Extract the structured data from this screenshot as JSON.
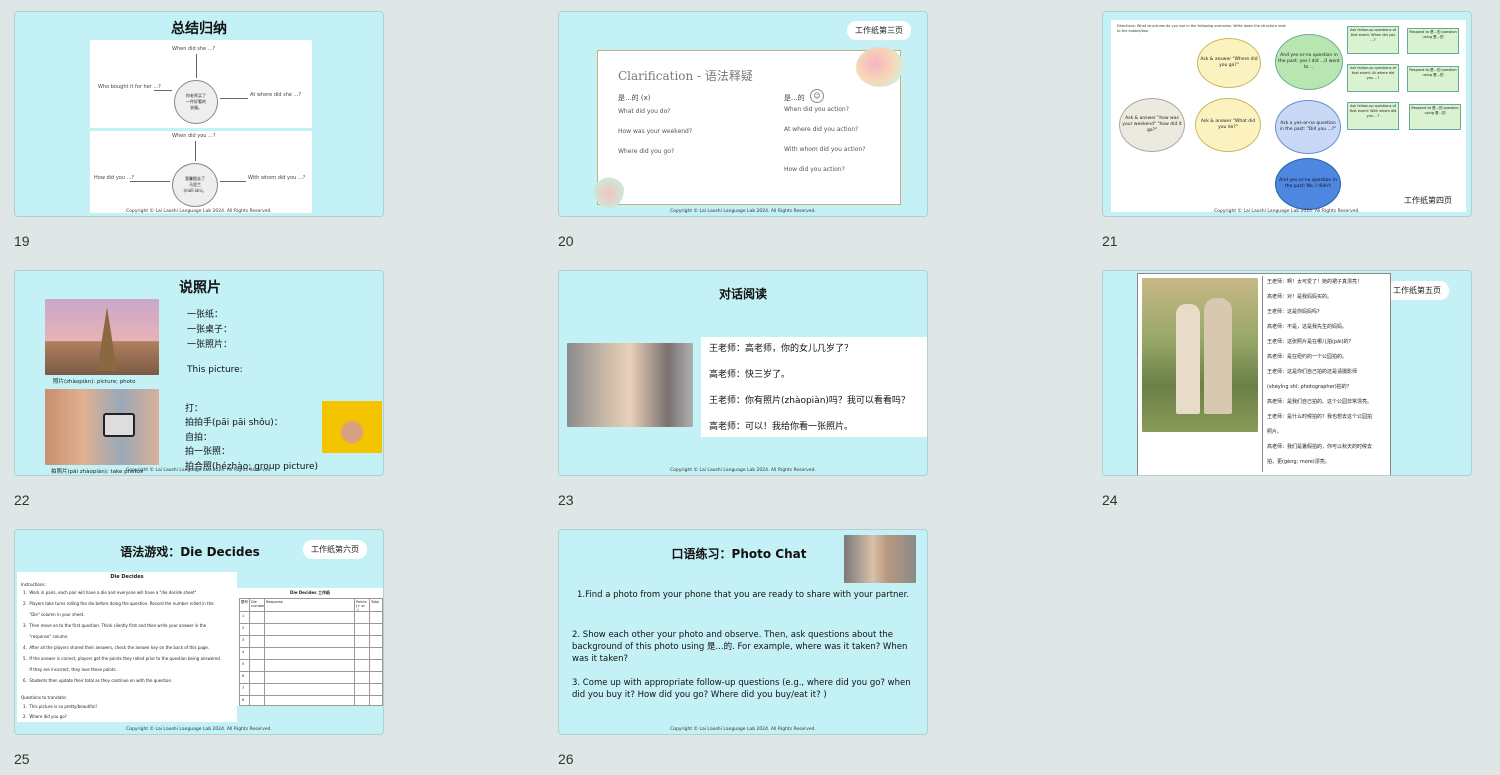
{
  "slides": {
    "s19": {
      "number": "19",
      "title": "总结归纳",
      "top_center": "你老师买了\n一件好看的\n衣服。",
      "top_q": [
        "When did she ...?",
        "Who bought it for her ...?",
        "At where did she ...?"
      ],
      "bottom_center": "我暑假去了\n马里兰\n(mǎlǐ lán)。",
      "bottom_q": [
        "When did you ...?",
        "How did you ...?",
        "With whom did you ...?"
      ],
      "copyright": "Copyright © Lai Laoshi Language Lab 2024. All Rights Reserved."
    },
    "s20": {
      "number": "20",
      "badge": "工作纸第三页",
      "heading": "Clarification - 语法释疑",
      "left_head": "是...的 (x)",
      "left_lines": [
        "What did you do?",
        "How was your weekend?",
        "Where did you go?"
      ],
      "right_head": "是...的",
      "right_lines": [
        "When did you action?",
        "At where did you action?",
        "With whom did you action?",
        "How did you action?"
      ],
      "copyright": "Copyright © Lai Laoshi Language Lab 2024. All Rights Reserved."
    },
    "s21": {
      "number": "21",
      "directions": "Directions: What structures do you use in the following scenarios. Write down the structure next to the bubble/box.",
      "ovals": [
        "Ask & answer \"Where did you go?\"",
        "And yes-or-no question in the past: yes I did ...(I went to ...",
        "Ask & answer \"how was your weekend\" \"how did it go?\"",
        "Ask & answer \"What did you do?\"",
        "Ask a yes-or-no question in the past: \"Did you ...?\"",
        "And yes-or-no question in the past: No, I didn't"
      ],
      "follow_boxes": [
        "Ask follow-up questions of that event: When did you ...?",
        "Ask follow-up questions of that event: At where did you ...?",
        "Ask follow-up questions of that event: With whom did you ...?"
      ],
      "respond_boxes": [
        "Respond to 是...的 question using 是...的",
        "Respond to 是...的 question using 是...的",
        "Respond to 是...的 question using 是...的"
      ],
      "badge": "工作纸第四页",
      "copyright": "Copyright © Lai Laoshi Language Lab 2024. All Rights Reserved."
    },
    "s22": {
      "number": "22",
      "title": "说照片",
      "caption1": "照片(zhàopiàn): picture; photo",
      "caption2": "拍照片(pāi zhàopiàn): take photos",
      "list1": [
        "一张纸：",
        "一张桌子：",
        "一张照片："
      ],
      "this_picture": "This picture:",
      "list2": [
        "打：",
        "拍拍手(pāi pāi shǒu)：",
        "自拍：",
        "拍一张照：",
        "拍合照(hézhào; group picture)"
      ],
      "copyright": "Copyright © Lai Laoshi Language Lab 2024. All Rights Reserved."
    },
    "s23": {
      "number": "23",
      "title": "对话阅读",
      "lines": [
        "王老师：高老师，你的女儿几岁了？",
        "高老师：快三岁了。",
        "王老师：你有照片(zhàopiàn)吗？我可以看看吗？",
        "高老师：可以！我给你看一张照片。"
      ],
      "copyright": "Copyright © Lai Laoshi Language Lab 2024. All Rights Reserved."
    },
    "s24": {
      "number": "24",
      "badge": "工作纸第五页",
      "lines": [
        "王老师：啊！太可爱了！她的裙子真漂亮！",
        "高老师：对！是我妈妈买的。",
        "王老师：这是你妈妈吗？",
        "高老师：不是，这是我先生的妈妈。",
        "王老师：这张照片是在哪儿拍(pāi)的？",
        "高老师：是在纽约的一个公园拍的。",
        "王老师：这是你们自己拍的还是请摄影师",
        "(shèyǐng shī; photographer)拍的？",
        "高老师：是我们自己拍的。这个公园非常漂亮。",
        "王老师：是什么时候拍的？我也想去这个公园拍",
        "照片。",
        "高老师：我们是暑假拍的，你可以秋天的时候去",
        "拍，更(gèng; more)漂亮。"
      ]
    },
    "s25": {
      "number": "25",
      "title": "语法游戏：Die Decides",
      "badge": "工作纸第六页",
      "doc_title": "Die Decides",
      "instructions_label": "Instructions:",
      "steps": [
        "1.  Work in pairs, each pair will have a die and everyone will have a \"die decide sheet\"",
        "2.  Players take turns rolling the die before doing the question. Record the number rolled in the",
        "     \"Die\" column in your sheet.",
        "3.  Then move on to the first question. Think silently first and then write your answer in the",
        "     \"response\" column.",
        "4.  After all the players shared their answers, check the answer key on the back of this page.",
        "5.  If the answer is correct, players get the points they rolled prior to the question being answered.",
        "     If they are incorrect, they lose those points.",
        "6.  Students then update their total as they continue on with the question."
      ],
      "translate_label": "Questions to translate:",
      "translate": [
        "1.  This picture is so pretty/beautiful!",
        "2.  Where did you go?"
      ],
      "sheet_title": "Die Decides 工作纸",
      "sheet_headers": [
        "题号",
        "Die number",
        "Response",
        "Points (+ or -)",
        "Total"
      ],
      "row_numbers": [
        "1",
        "2",
        "3",
        "4",
        "5",
        "6",
        "7",
        "8"
      ],
      "copyright": "Copyright © Lai Laoshi Language Lab 2024. All Rights Reserved."
    },
    "s26": {
      "number": "26",
      "title": "口语练习：Photo Chat",
      "p1": "1.Find a photo from your phone that you are ready to share with your partner.",
      "p2": "2. Show each other your photo and observe. Then, ask questions about the background of this photo using 是...的. For example, where was it taken? When was it taken?",
      "p3": "3. Come up with appropriate follow-up questions (e.g., where did you go? when did you buy it? How did you go? Where did you buy/eat it? )",
      "copyright": "Copyright © Lai Laoshi Language Lab 2024. All Rights Reserved."
    }
  }
}
